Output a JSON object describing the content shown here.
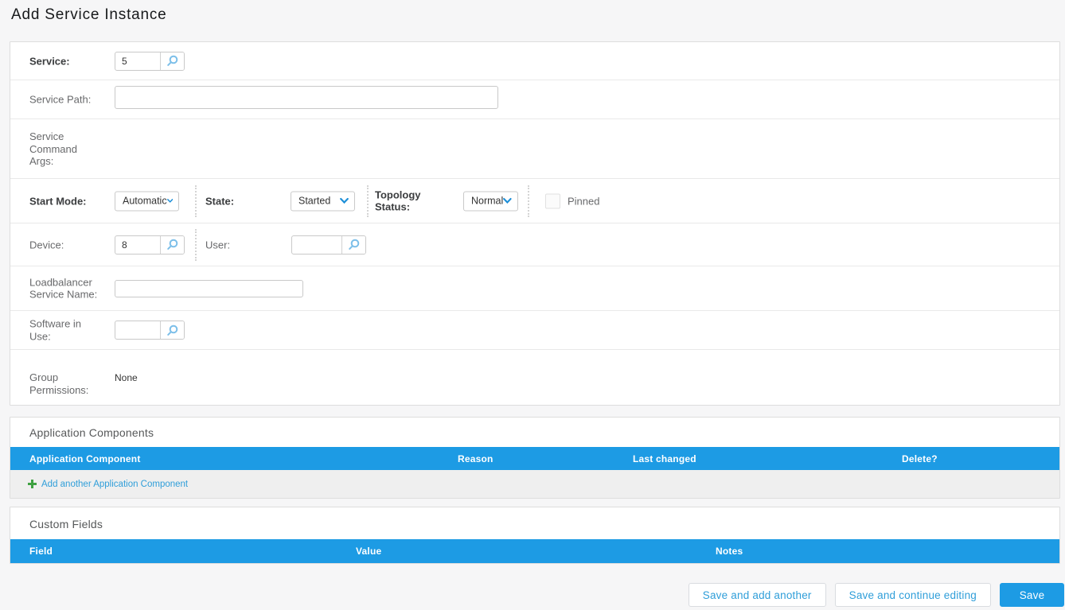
{
  "page": {
    "title": "Add Service Instance"
  },
  "theme": {
    "accent_blue": "#1d9be4",
    "link_blue": "#2f9ed9",
    "add_green": "#3fa142",
    "panel_border": "#dddddd"
  },
  "form": {
    "service": {
      "label": "Service:",
      "value": "5"
    },
    "service_path": {
      "label": "Service Path:",
      "value": ""
    },
    "service_command_args": {
      "label": "Service Command Args:"
    },
    "start_mode": {
      "label": "Start Mode:",
      "value": "Automatic"
    },
    "state": {
      "label": "State:",
      "value": "Started"
    },
    "topology_status": {
      "label": "Topology Status:",
      "value": "Normal"
    },
    "pinned": {
      "label": "Pinned",
      "checked": false
    },
    "device": {
      "label": "Device:",
      "value": "8"
    },
    "user": {
      "label": "User:",
      "value": ""
    },
    "loadbalancer_service_name": {
      "label": "Loadbalancer Service Name:",
      "value": ""
    },
    "software_in_use": {
      "label": "Software in Use:",
      "value": ""
    },
    "group_permissions": {
      "label": "Group Permissions:",
      "value": "None"
    }
  },
  "application_components": {
    "title": "Application Components",
    "columns": [
      "Application Component",
      "Reason",
      "Last changed",
      "Delete?"
    ],
    "add_link": "Add another Application Component",
    "rows": []
  },
  "custom_fields": {
    "title": "Custom Fields",
    "columns": [
      "Field",
      "Value",
      "Notes"
    ],
    "rows": []
  },
  "actions": {
    "save_and_add_another": "Save and add another",
    "save_and_continue": "Save and continue editing",
    "save": "Save"
  }
}
